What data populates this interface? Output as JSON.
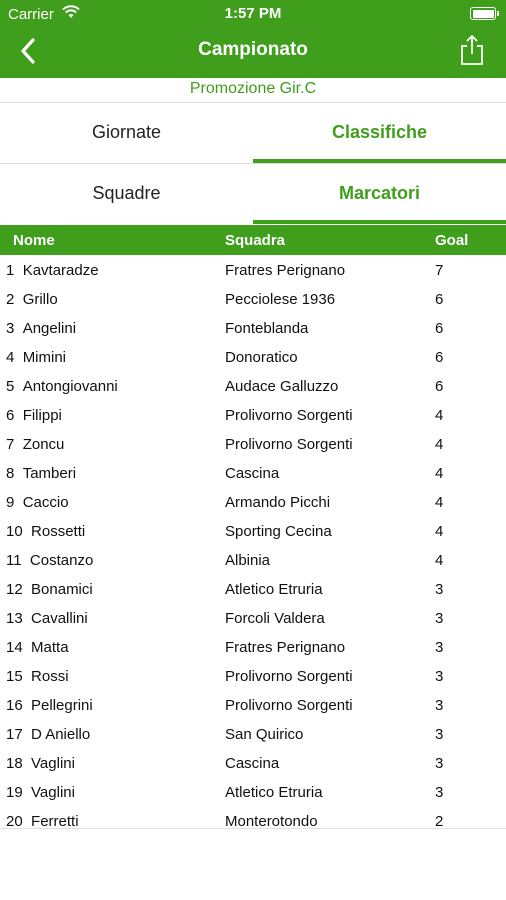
{
  "status_bar": {
    "carrier": "Carrier",
    "time": "1:57 PM"
  },
  "nav": {
    "title": "Campionato",
    "back_icon": "back-chevron-icon",
    "share_icon": "share-icon"
  },
  "subtitle": "Promozione Gir.C",
  "tabs_primary": [
    {
      "label": "Giornate",
      "active": false
    },
    {
      "label": "Classifiche",
      "active": true
    }
  ],
  "tabs_secondary": [
    {
      "label": "Squadre",
      "active": false
    },
    {
      "label": "Marcatori",
      "active": true
    }
  ],
  "table": {
    "headers": [
      "Nome",
      "Squadra",
      "Goal"
    ],
    "rows": [
      {
        "pos": "1",
        "name": "Kavtaradze",
        "team": "Fratres Perignano",
        "goals": "7"
      },
      {
        "pos": "2",
        "name": "Grillo",
        "team": "Pecciolese 1936",
        "goals": "6"
      },
      {
        "pos": "3",
        "name": "Angelini",
        "team": "Fonteblanda",
        "goals": "6"
      },
      {
        "pos": "4",
        "name": "Mimini",
        "team": "Donoratico",
        "goals": "6"
      },
      {
        "pos": "5",
        "name": "Antongiovanni",
        "team": "Audace Galluzzo",
        "goals": "6"
      },
      {
        "pos": "6",
        "name": "Filippi",
        "team": "Prolivorno Sorgenti",
        "goals": "4"
      },
      {
        "pos": "7",
        "name": "Zoncu",
        "team": "Prolivorno Sorgenti",
        "goals": "4"
      },
      {
        "pos": "8",
        "name": "Tamberi",
        "team": "Cascina",
        "goals": "4"
      },
      {
        "pos": "9",
        "name": "Caccio",
        "team": "Armando Picchi",
        "goals": "4"
      },
      {
        "pos": "10",
        "name": "Rossetti",
        "team": "Sporting Cecina",
        "goals": "4"
      },
      {
        "pos": "11",
        "name": "Costanzo",
        "team": "Albinia",
        "goals": "4"
      },
      {
        "pos": "12",
        "name": "Bonamici",
        "team": "Atletico Etruria",
        "goals": "3"
      },
      {
        "pos": "13",
        "name": "Cavallini",
        "team": "Forcoli Valdera",
        "goals": "3"
      },
      {
        "pos": "14",
        "name": "Matta",
        "team": "Fratres Perignano",
        "goals": "3"
      },
      {
        "pos": "15",
        "name": "Rossi",
        "team": "Prolivorno Sorgenti",
        "goals": "3"
      },
      {
        "pos": "16",
        "name": "Pellegrini",
        "team": "Prolivorno Sorgenti",
        "goals": "3"
      },
      {
        "pos": "17",
        "name": "D Aniello",
        "team": "San Quirico",
        "goals": "3"
      },
      {
        "pos": "18",
        "name": "Vaglini",
        "team": "Cascina",
        "goals": "3"
      },
      {
        "pos": "19",
        "name": "Vaglini",
        "team": "Atletico Etruria",
        "goals": "3"
      },
      {
        "pos": "20",
        "name": "Ferretti",
        "team": "Monterotondo",
        "goals": "2"
      }
    ]
  },
  "colors": {
    "brand": "#3f9e1c",
    "text": "#111111",
    "inactive_tab": "#222222"
  }
}
